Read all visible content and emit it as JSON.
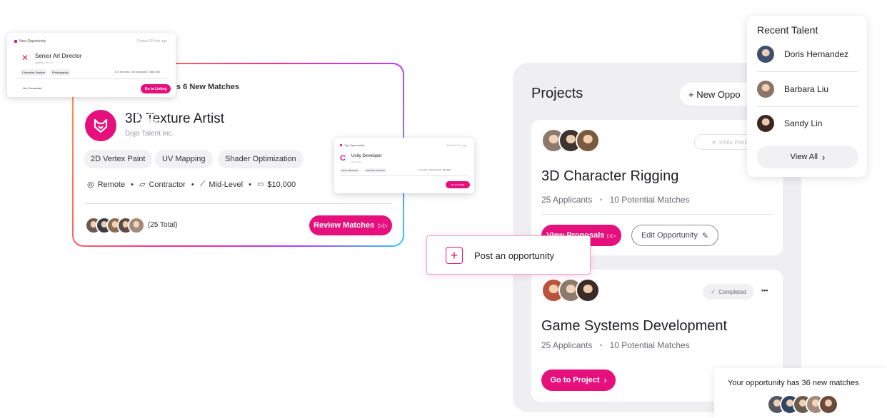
{
  "new_opportunity_card": {
    "header": "New Opportunity",
    "header_right": "Posted 32 min ago",
    "title": "Senior Art Director",
    "company": "Applied Art Co.",
    "tags": [
      "Character System",
      "Photography"
    ],
    "meta": "6-9 months  •  40 hours/wk  •  $50,000",
    "footer_left": "Not Connected",
    "button": "Go to Listing",
    "accent": "#e5107c"
  },
  "main_card": {
    "matches_text": "s 6 New Matches",
    "title": "3D Texture Artist",
    "company": "Dojo Talent inc.",
    "skills": [
      "2D Vertex Paint",
      "UV Mapping",
      "Shader Optimization"
    ],
    "meta": {
      "location": "Remote",
      "type": "Contractor",
      "level": "Mid-Level",
      "budget": "$10,000"
    },
    "total": "(25 Total)",
    "button": "Review Matches",
    "logo_color": "#e5107c"
  },
  "unity_card": {
    "header": "Top Opportunity",
    "header_right": "Posted 3 hr ago",
    "title": "Unity Developer",
    "company": "Dev Studio",
    "tags": [
      "Game Mechanics",
      "Character Animation"
    ],
    "meta": "3 months  •  30 hours/wk  •  $30,000",
    "button": "Go to Listing"
  },
  "post_opportunity": {
    "label": "Post an opportunity"
  },
  "projects": {
    "title": "Projects",
    "new_button": "+ New Oppo",
    "items": [
      {
        "status": "Invite Pending",
        "title": "3D Character Rigging",
        "applicants": "25 Applicants",
        "matches": "10 Potential Matches",
        "primary_button": "View Proposals",
        "secondary_button": "Edit Opportunity"
      },
      {
        "status": "Completed",
        "menu": "•••",
        "title": "Game Systems Development",
        "applicants": "25 Applicants",
        "matches": "10 Potential Matches",
        "primary_button": "Go to Project"
      }
    ]
  },
  "recent_talent": {
    "title": "Recent Talent",
    "people": [
      "Doris Hernandez",
      "Barbara Liu",
      "Sandy Lin"
    ],
    "view_all": "View All"
  },
  "notification": {
    "text": "Your opportunity has 36 new matches"
  },
  "colors": {
    "accent": "#e5107c",
    "panel": "#efeff1"
  }
}
